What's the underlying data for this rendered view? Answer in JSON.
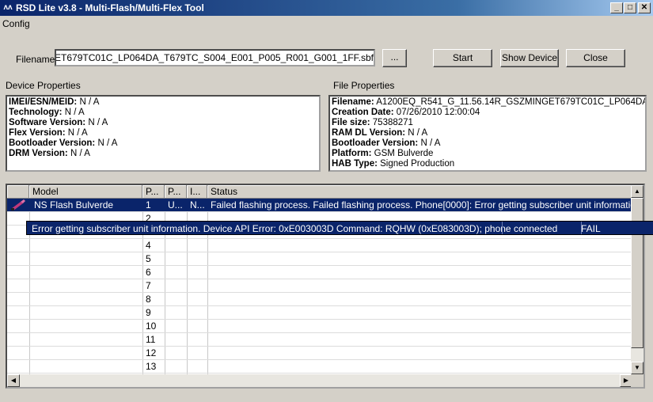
{
  "window": {
    "title": "RSD Lite v3.8 - Multi-Flash/Multi-Flex Tool",
    "icon": "motorola-logo-icon",
    "controls": {
      "minimize": "_",
      "maximize": "□",
      "close": "✕"
    }
  },
  "menu": {
    "config": "Config"
  },
  "filename": {
    "label": "Filename:",
    "value": "A1200EQ_R541_G_11.56.14R_GSZMINGET679TC01C_LP064DA_T679TC_S004_E001_P005_R001_G001_1FF.sbf"
  },
  "buttons": {
    "browse": "...",
    "start": "Start",
    "show_device": "Show Device",
    "close": "Close"
  },
  "device_properties": {
    "heading": "Device Properties",
    "items": [
      {
        "label": "IMEI/ESN/MEID:",
        "value": " N / A"
      },
      {
        "label": "Technology:",
        "value": " N / A"
      },
      {
        "label": "Software Version:",
        "value": " N / A"
      },
      {
        "label": "Flex Version:",
        "value": " N / A"
      },
      {
        "label": "Bootloader Version:",
        "value": " N / A"
      },
      {
        "label": "DRM Version:",
        "value": " N / A"
      }
    ]
  },
  "file_properties": {
    "heading": "File Properties",
    "items": [
      {
        "label": "Filename:",
        "value": " A1200EQ_R541_G_11.56.14R_GSZMINGET679TC01C_LP064DA_T679TC_S004_E001_P005_R001_G001_1FF.sbf"
      },
      {
        "label": "Creation Date:",
        "value": " 07/26/2010 12:00:04"
      },
      {
        "label": "File size:",
        "value": " 75388271"
      },
      {
        "label": "RAM DL Version:",
        "value": " N / A"
      },
      {
        "label": "Bootloader Version:",
        "value": " N / A"
      },
      {
        "label": "Platform:",
        "value": " GSM Bulverde"
      },
      {
        "label": "HAB Type:",
        "value": " Signed Production"
      }
    ]
  },
  "grid": {
    "columns": [
      "",
      "Model",
      "P...",
      "P...",
      "I...",
      "Status"
    ],
    "rows": [
      {
        "model": "NS Flash Bulverde",
        "port": "1",
        "c3": "U...",
        "c4": "N...",
        "status": "Failed flashing process. Failed flashing process. Phone[0000]: Error getting subscriber unit information. Device API Error: 0xE003003D Command: RQHW (0xE083003D); phone connected"
      },
      {
        "port": "2"
      },
      {
        "port": "3"
      },
      {
        "port": "4"
      },
      {
        "port": "5"
      },
      {
        "port": "6"
      },
      {
        "port": "7"
      },
      {
        "port": "8"
      },
      {
        "port": "9"
      },
      {
        "port": "10"
      },
      {
        "port": "11"
      },
      {
        "port": "12"
      },
      {
        "port": "13"
      }
    ],
    "tooltip": {
      "text": "Error getting subscriber unit information. Device API Error: 0xE003003D Command: RQHW (0xE083003D); phone connected",
      "result": "FAIL"
    }
  }
}
